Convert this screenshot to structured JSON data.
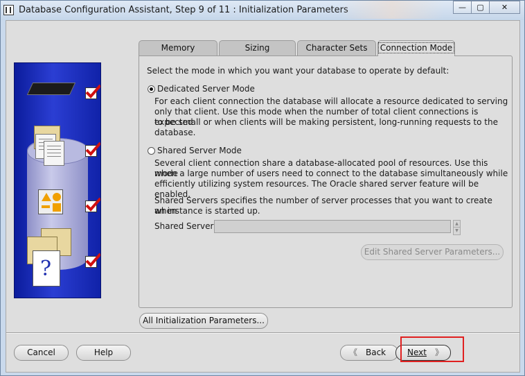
{
  "window": {
    "title": "Database Configuration Assistant, Step 9 of 11 : Initialization Parameters",
    "controls": {
      "minimize": "—",
      "maximize": "▢",
      "close": "✕"
    }
  },
  "tabs": [
    {
      "label": "Memory",
      "active": false
    },
    {
      "label": "Sizing",
      "active": false
    },
    {
      "label": "Character Sets",
      "active": false
    },
    {
      "label": "Connection Mode",
      "active": true
    }
  ],
  "panel": {
    "intro": "Select the mode in which you want your database to operate by default:",
    "dedicated": {
      "label": "Dedicated Server Mode",
      "selected": true,
      "description": [
        "For each client connection the database will allocate a resource dedicated to serving",
        "only that client.  Use this mode when the number of total client connections is expected",
        "to be small or when clients will be making persistent, long-running requests to the",
        "database."
      ]
    },
    "shared": {
      "label": "Shared Server Mode",
      "selected": false,
      "description": [
        "Several client connection share a database-allocated pool of resources.  Use this mode",
        "when a large number of users need to connect to the database simultaneously while",
        "efficiently utilizing system resources.  The Oracle shared server feature will be enabled."
      ],
      "servers_note": [
        "Shared Servers specifies the number of server processes that you want to create when",
        "an instance is started up."
      ],
      "field_label": "Shared Server:",
      "field_value": "",
      "edit_button": "Edit Shared Server Parameters..."
    }
  },
  "all_params_button": "All Initialization Parameters...",
  "footer": {
    "cancel": "Cancel",
    "help": "Help",
    "back": "Back",
    "next": "Next"
  },
  "colors": {
    "highlight": "#e02020",
    "graphic_blue": "#1a2fc0",
    "check_red": "#d01010"
  }
}
